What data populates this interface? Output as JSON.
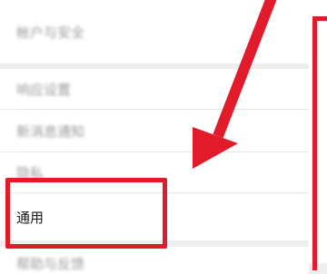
{
  "menu": {
    "items": [
      {
        "label": "帐户与安全"
      },
      {
        "label": "响应设置"
      },
      {
        "label": "新消息通知"
      },
      {
        "label": "隐私"
      },
      {
        "label": "通用"
      },
      {
        "label": "帮助与反馈"
      }
    ]
  },
  "annotation": {
    "highlight_color": "#e21b2b",
    "arrow_icon": "red-arrow-pointing-down-left"
  }
}
